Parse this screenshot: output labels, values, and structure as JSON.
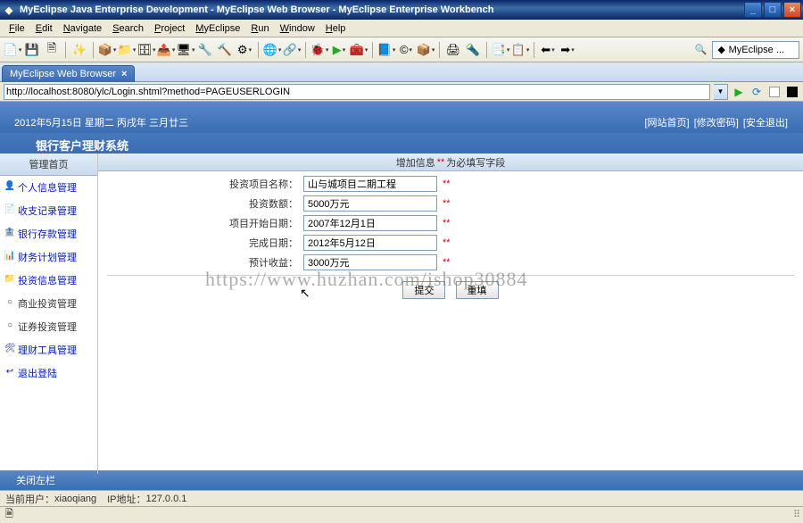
{
  "window": {
    "title": "MyEclipse Java Enterprise Development - MyEclipse Web Browser - MyEclipse Enterprise Workbench"
  },
  "menu": {
    "file": "File",
    "edit": "Edit",
    "navigate": "Navigate",
    "search": "Search",
    "project": "Project",
    "myeclipse": "MyEclipse",
    "run": "Run",
    "window": "Window",
    "help": "Help"
  },
  "ide_search": {
    "label": "MyEclipse ..."
  },
  "tab": {
    "label": "MyEclipse Web Browser",
    "close": "×"
  },
  "url": {
    "value": "http://localhost:8080/ylc/Login.shtml?method=PAGEUSERLOGIN"
  },
  "header": {
    "date": "2012年5月15日 星期二 丙戌年 三月廿三",
    "system": "银行客户理财系统",
    "link_home": "[网站首页]",
    "link_pwd": "[修改密码]",
    "link_exit": "[安全退出]"
  },
  "sidebar": {
    "home": "管理首页",
    "items": [
      {
        "label": "个人信息管理",
        "icon": "👤"
      },
      {
        "label": "收支记录管理",
        "icon": "📄"
      },
      {
        "label": "银行存款管理",
        "icon": "🏦"
      },
      {
        "label": "财务计划管理",
        "icon": "📊"
      },
      {
        "label": "投资信息管理",
        "icon": "📁"
      },
      {
        "label": "商业投资管理",
        "icon": ""
      },
      {
        "label": "证券投资管理",
        "icon": ""
      },
      {
        "label": "理财工具管理",
        "icon": "🛠"
      },
      {
        "label": "退出登陆",
        "icon": "↩"
      }
    ]
  },
  "form": {
    "title_prefix": "增加信息",
    "title_req_marker": "**",
    "title_suffix": "为必填写字段",
    "fields": [
      {
        "label": "投资项目名称：",
        "value": "山与城项目二期工程"
      },
      {
        "label": "投资数额：",
        "value": "5000万元"
      },
      {
        "label": "项目开始日期：",
        "value": "2007年12月1日"
      },
      {
        "label": "完成日期：",
        "value": "2012年5月12日"
      },
      {
        "label": "预计收益：",
        "value": "3000万元"
      }
    ],
    "star": "**",
    "submit": "提交",
    "reset": "重填"
  },
  "watermark": "https://www.huzhan.com/ishop30884",
  "collapse_left": "关闭左栏",
  "status": {
    "user_label": "当前用户：",
    "user": "xiaoqiang",
    "ip_label": "IP地址：",
    "ip": "127.0.0.1"
  }
}
